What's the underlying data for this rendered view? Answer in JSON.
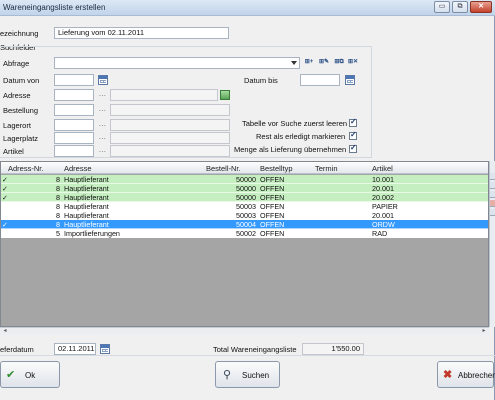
{
  "window": {
    "title": "Wareneingangsliste erstellen",
    "controls": {
      "minimize": "▭",
      "restore": "⧉",
      "close": "✕"
    }
  },
  "form": {
    "bezeichnung_label": "ezeichnung",
    "bezeichnung_value": "Lieferung vom 02.11.2011",
    "suchfelder_label": "Suchfelder",
    "abfrage_label": "Abfrage",
    "abfrage_value": "",
    "datum_von_label": "Datum von",
    "datum_bis_label": "Datum bis",
    "adresse_label": "Adresse",
    "bestellung_label": "Bestellung",
    "lagerort_label": "Lagerort",
    "lagerplatz_label": "Lagerplatz",
    "artikel_label": "Artikel",
    "ellipsis": "...",
    "options": [
      {
        "label": "Tabelle vor Suche zuerst leeren",
        "checked": true
      },
      {
        "label": "Rest als erledigt markieren",
        "checked": true
      },
      {
        "label": "Menge als Lieferung übernehmen",
        "checked": true
      }
    ],
    "toolbar_icons": [
      "filter-add-icon",
      "filter-edit-icon",
      "filter-copy-icon",
      "filter-delete-icon"
    ]
  },
  "table": {
    "columns": [
      "Adress-Nr.",
      "Adresse",
      "Bestell-Nr.",
      "Bestelltyp",
      "Termin",
      "Artikel"
    ],
    "rows": [
      {
        "check": "✓",
        "adress_nr": "8",
        "adresse": "Hauptlieferant",
        "bestell_nr": "50000",
        "typ": "OFFEN",
        "termin": "",
        "artikel": "10.001",
        "style": "green"
      },
      {
        "check": "✓",
        "adress_nr": "8",
        "adresse": "Hauptlieferant",
        "bestell_nr": "50000",
        "typ": "OFFEN",
        "termin": "",
        "artikel": "20.001",
        "style": "green"
      },
      {
        "check": "✓",
        "adress_nr": "8",
        "adresse": "Hauptlieferant",
        "bestell_nr": "50000",
        "typ": "OFFEN",
        "termin": "",
        "artikel": "20.002",
        "style": "green"
      },
      {
        "check": "",
        "adress_nr": "8",
        "adresse": "Hauptlieferant",
        "bestell_nr": "50003",
        "typ": "OFFEN",
        "termin": "",
        "artikel": "PAPIER",
        "style": "white"
      },
      {
        "check": "",
        "adress_nr": "8",
        "adresse": "Hauptlieferant",
        "bestell_nr": "50003",
        "typ": "OFFEN",
        "termin": "",
        "artikel": "20.001",
        "style": "white"
      },
      {
        "check": "✓",
        "adress_nr": "8",
        "adresse": "Hauptlieferant",
        "bestell_nr": "50004",
        "typ": "OFFEN",
        "termin": "",
        "artikel": "ORDW",
        "style": "sel"
      },
      {
        "check": "",
        "adress_nr": "5",
        "adresse": "Importlieferungen",
        "bestell_nr": "50002",
        "typ": "OFFEN",
        "termin": "",
        "artikel": "RAD",
        "style": "white"
      }
    ]
  },
  "footer": {
    "lieferdatum_label": "eferdatum",
    "lieferdatum_value": "02.11.2011",
    "total_label": "Total Wareneingangsliste",
    "total_value": "1'550.00"
  },
  "buttons": {
    "ok": "Ok",
    "suchen": "Suchen",
    "abbrechen": "Abbrechen"
  },
  "colors": {
    "completed_row": "#c6efc1",
    "selected_row": "#3399ff",
    "grid_empty": "#a5a5a5"
  }
}
